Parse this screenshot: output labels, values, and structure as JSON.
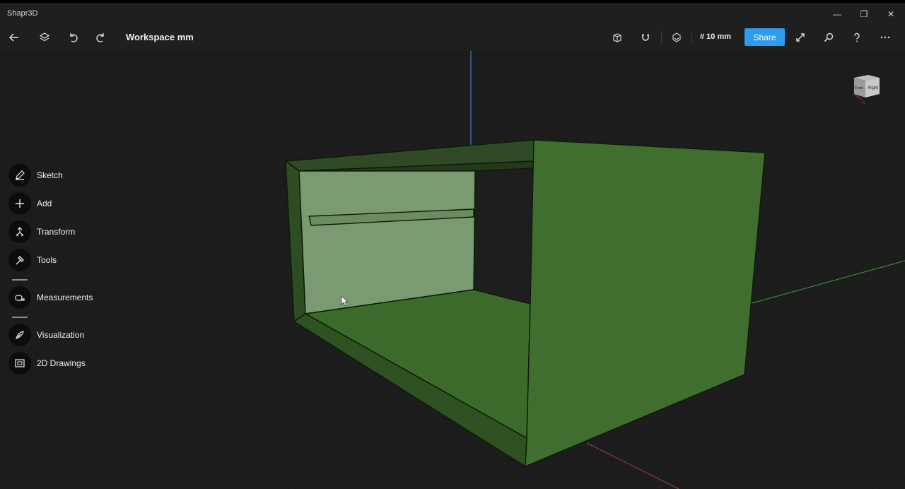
{
  "app": {
    "title": "Shapr3D"
  },
  "window_controls": {
    "minimize": "—",
    "restore": "❐",
    "close": "✕"
  },
  "toolbar": {
    "workspace_title": "Workspace mm",
    "grid_size": "# 10 mm",
    "share_label": "Share"
  },
  "side_menu": {
    "items": [
      {
        "label": "Sketch",
        "icon": "sketch-pencil-icon"
      },
      {
        "label": "Add",
        "icon": "plus-icon"
      },
      {
        "label": "Transform",
        "icon": "transform-arrows-icon"
      },
      {
        "label": "Tools",
        "icon": "hammer-icon"
      },
      {
        "label": "Measurements",
        "icon": "tape-measure-icon"
      },
      {
        "label": "Visualization",
        "icon": "visualization-icon"
      },
      {
        "label": "2D Drawings",
        "icon": "drawing-sheet-icon"
      }
    ]
  },
  "view_cube": {
    "front": "Front",
    "right": "Right"
  },
  "colors": {
    "background": "#1c1c1c",
    "accent": "#2d9bf0",
    "model_green": "#3d6b2c",
    "model_selected_face": "#7a9a72"
  }
}
